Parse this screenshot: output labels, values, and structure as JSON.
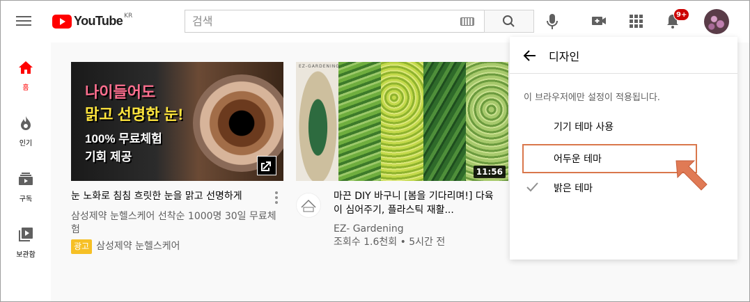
{
  "header": {
    "logo_text": "YouTube",
    "logo_region": "KR",
    "search_placeholder": "검색",
    "notification_count": "9+"
  },
  "sidebar": {
    "items": [
      {
        "label": "홈",
        "icon": "home-icon",
        "active": true
      },
      {
        "label": "인기",
        "icon": "trending-fire-icon",
        "active": false
      },
      {
        "label": "구독",
        "icon": "subscriptions-icon",
        "active": false
      },
      {
        "label": "보관함",
        "icon": "library-icon",
        "active": false
      }
    ]
  },
  "videos": [
    {
      "thumb_lines": [
        "나이들어도",
        "맑고 선명한 눈!",
        "100% 무료체험",
        "기회 제공"
      ],
      "title": "눈 노화로 침침 흐릿한 눈을 맑고 선명하게",
      "description": "삼성제약 눈헬스케어 선착순 1000명 30일 무료체험",
      "ad_badge": "광고",
      "advertiser": "삼성제약 눈헬스케어"
    },
    {
      "thumb_brand": "EZ-GARDENING",
      "duration": "11:56",
      "title": "마끈 DIY 바구니 [봄을 기다리며!] 다육이 심어주기, 플라스틱 재활...",
      "channel": "EZ- Gardening",
      "stats": "조회수 1.6천회 • 5시간 전"
    }
  ],
  "appearance_menu": {
    "title": "디자인",
    "note": "이 브라우저에만 설정이 적용됩니다.",
    "options": [
      {
        "label": "기기 테마 사용",
        "selected": false
      },
      {
        "label": "어두운 테마",
        "selected": false,
        "highlighted": true
      },
      {
        "label": "밝은 테마",
        "selected": true
      }
    ]
  },
  "colors": {
    "brand_red": "#ff0000",
    "badge_red": "#cc0000",
    "ad_yellow": "#f6c025",
    "highlight_orange": "#d9774b"
  }
}
